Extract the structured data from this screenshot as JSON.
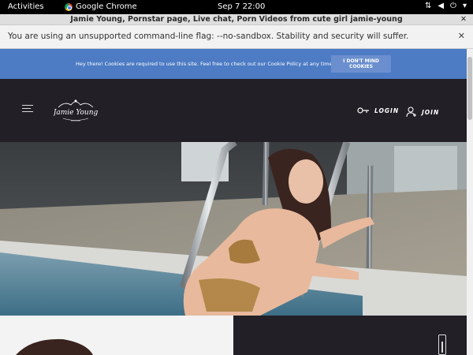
{
  "system_bar": {
    "activities_label": "Activities",
    "app_name": "Google Chrome",
    "clock": "Sep 7  22:00"
  },
  "browser": {
    "window_title": "Jamie Young, Pornstar page, Live chat, Porn Videos from cute girl jamie-young",
    "infobar_message": "You are using an unsupported command-line flag: --no-sandbox. Stability and security will suffer."
  },
  "cookie_banner": {
    "text": "Hey there! Cookies are required to use this site. Feel free to check out our Cookie Policy at any time.",
    "button_label": "I DON'T MIND COOKIES"
  },
  "header": {
    "logo_text": "Jamie Young",
    "login_label": "LOGIN",
    "join_label": "JOIN"
  },
  "colors": {
    "cookie_bg": "#4d7bc4",
    "header_bg": "#221f27"
  }
}
